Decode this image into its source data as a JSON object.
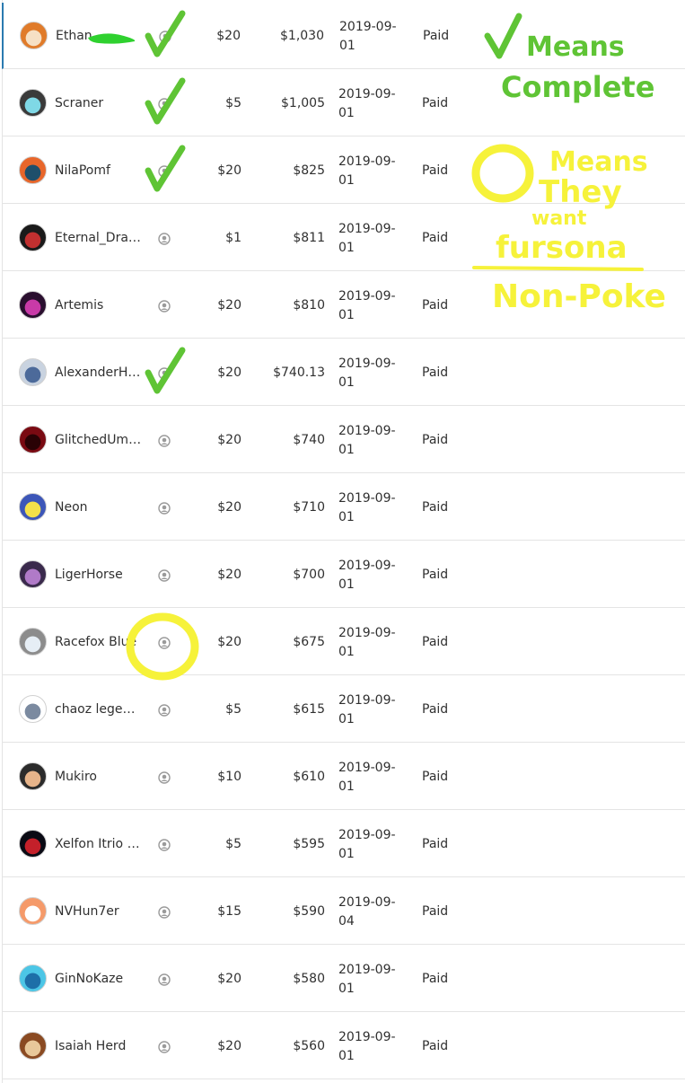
{
  "rows": [
    {
      "name": "Ethan",
      "tier": "$20",
      "lifetime": "$1,030",
      "date": "2019-09-01",
      "status": "Paid",
      "avatar_colors": [
        "#e07b2a",
        "#f6e0c4"
      ]
    },
    {
      "name": "Scraner",
      "tier": "$5",
      "lifetime": "$1,005",
      "date": "2019-09-01",
      "status": "Paid",
      "avatar_colors": [
        "#3a3a3a",
        "#7fd8e6"
      ]
    },
    {
      "name": "NilaPomf",
      "tier": "$20",
      "lifetime": "$825",
      "date": "2019-09-01",
      "status": "Paid",
      "avatar_colors": [
        "#e8662a",
        "#1f4f6b"
      ]
    },
    {
      "name": "Eternal_Drag…",
      "tier": "$1",
      "lifetime": "$811",
      "date": "2019-09-01",
      "status": "Paid",
      "avatar_colors": [
        "#1a1a1a",
        "#c23030"
      ]
    },
    {
      "name": "Artemis",
      "tier": "$20",
      "lifetime": "$810",
      "date": "2019-09-01",
      "status": "Paid",
      "avatar_colors": [
        "#2a0f2f",
        "#c93aa8"
      ]
    },
    {
      "name": "AlexanderHe…",
      "tier": "$20",
      "lifetime": "$740.13",
      "date": "2019-09-01",
      "status": "Paid",
      "avatar_colors": [
        "#c9d3e0",
        "#4c6a9a"
      ]
    },
    {
      "name": "GlitchedUmbre",
      "tier": "$20",
      "lifetime": "$740",
      "date": "2019-09-01",
      "status": "Paid",
      "avatar_colors": [
        "#7a0a12",
        "#2a0205"
      ]
    },
    {
      "name": "Neon",
      "tier": "$20",
      "lifetime": "$710",
      "date": "2019-09-01",
      "status": "Paid",
      "avatar_colors": [
        "#3c56b8",
        "#f3e04a"
      ]
    },
    {
      "name": "LigerHorse",
      "tier": "$20",
      "lifetime": "$700",
      "date": "2019-09-01",
      "status": "Paid",
      "avatar_colors": [
        "#3a2a4c",
        "#b07ac8"
      ]
    },
    {
      "name": "Racefox Blue",
      "tier": "$20",
      "lifetime": "$675",
      "date": "2019-09-01",
      "status": "Paid",
      "avatar_colors": [
        "#8c8c8c",
        "#e6eef5"
      ]
    },
    {
      "name": "chaoz legends",
      "tier": "$5",
      "lifetime": "$615",
      "date": "2019-09-01",
      "status": "Paid",
      "avatar_colors": [
        "#ffffff",
        "#7b8aa0"
      ]
    },
    {
      "name": "Mukiro",
      "tier": "$10",
      "lifetime": "$610",
      "date": "2019-09-01",
      "status": "Paid",
      "avatar_colors": [
        "#2b2b2b",
        "#e7b48a"
      ]
    },
    {
      "name": "Xelfon Itrio K…",
      "tier": "$5",
      "lifetime": "$595",
      "date": "2019-09-01",
      "status": "Paid",
      "avatar_colors": [
        "#0a0a14",
        "#c4202a"
      ]
    },
    {
      "name": "NVHun7er",
      "tier": "$15",
      "lifetime": "$590",
      "date": "2019-09-04",
      "status": "Paid",
      "avatar_colors": [
        "#f59a6a",
        "#ffffff"
      ]
    },
    {
      "name": "GinNoKaze",
      "tier": "$20",
      "lifetime": "$580",
      "date": "2019-09-01",
      "status": "Paid",
      "avatar_colors": [
        "#4cc6e6",
        "#1d6fa8"
      ]
    },
    {
      "name": "Isaiah Herd",
      "tier": "$20",
      "lifetime": "$560",
      "date": "2019-09-01",
      "status": "Paid",
      "avatar_colors": [
        "#8a4a22",
        "#e8c89a"
      ]
    }
  ],
  "icons": {
    "pledge": "person-circle-icon"
  },
  "annotations": {
    "check_legend": [
      "Means",
      "Complete"
    ],
    "circle_legend": [
      "Means",
      "They",
      "want",
      "fursona",
      "Non-Poke"
    ],
    "check_color": "#5fc435",
    "circle_color": "#f6f23a",
    "redaction_color": "#2fd12f"
  },
  "colors": {
    "divider": "#e4e4e4",
    "text": "#303030",
    "icon": "#9a9a9a",
    "selected_edge": "#2a7ab0"
  }
}
